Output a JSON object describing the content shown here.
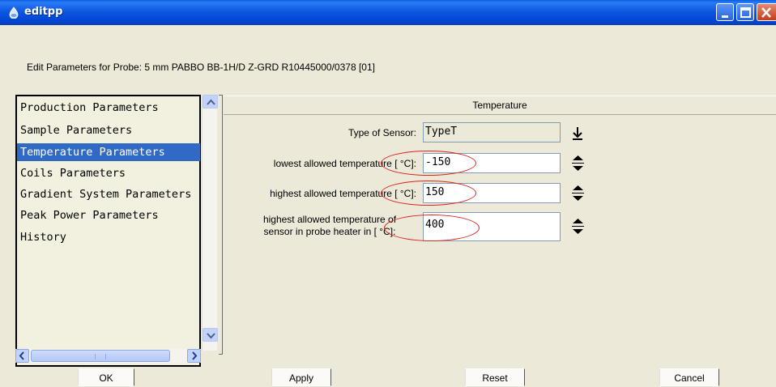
{
  "window": {
    "title": "editpp",
    "icon": "app-drop-icon",
    "controls": [
      "minimize-icon",
      "maximize-icon",
      "close-icon"
    ]
  },
  "probe_label": "Edit Parameters for Probe:  5 mm PABBO BB-1H/D Z-GRD R10445000/0378 [01]",
  "sidebar": {
    "items": [
      {
        "label": "Production Parameters"
      },
      {
        "label": "Sample Parameters"
      },
      {
        "label": "Temperature Parameters"
      },
      {
        "label": "Coils Parameters"
      },
      {
        "label": "Gradient System Parameters"
      },
      {
        "label": "Peak Power Parameters"
      },
      {
        "label": "History"
      }
    ],
    "selected_index": 2
  },
  "panel": {
    "header": "Temperature",
    "fields": [
      {
        "label": "Type of Sensor:",
        "value": "TypeT"
      },
      {
        "label": "lowest allowed temperature [ °C]:",
        "value": "-150"
      },
      {
        "label": "highest allowed temperature [ °C]:",
        "value": "150"
      },
      {
        "label_line1": "highest allowed temperature of",
        "label_line2": "sensor in probe heater in [ °C]:",
        "value": "400"
      }
    ]
  },
  "buttons": {
    "ok": "OK",
    "apply": "Apply",
    "reset": "Reset",
    "cancel": "Cancel"
  },
  "colors": {
    "titlebar": "#0a5fe0",
    "selection": "#316ac5",
    "annotation": "#d9231b",
    "background": "#ece9d8"
  }
}
